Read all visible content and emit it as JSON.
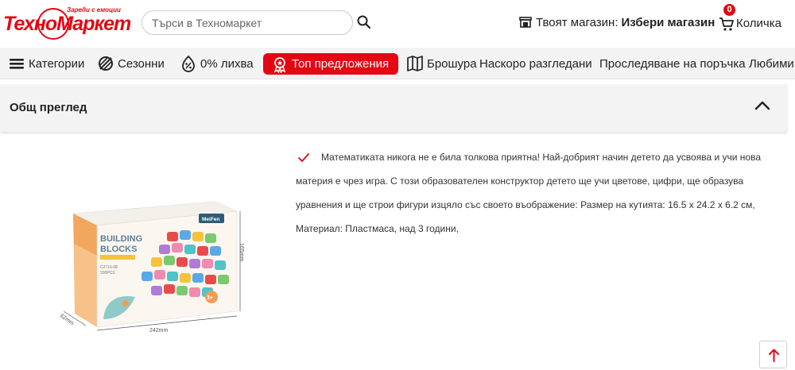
{
  "header": {
    "logo_text": "ТехноМаркет",
    "logo_tagline": "Зареди с емоции",
    "search_placeholder": "Търси в Техномаркет",
    "store_label": "Твоят магазин:",
    "store_value": "Избери магазин",
    "cart_count": "0",
    "cart_label": "Количка"
  },
  "nav": {
    "items": [
      {
        "label": "Категории",
        "icon": "menu-icon"
      },
      {
        "label": "Сезонни",
        "icon": "seasonal-icon"
      },
      {
        "label": "0% лихва",
        "icon": "percent-icon"
      },
      {
        "label": "Топ предложения",
        "icon": "award-icon"
      },
      {
        "label": "Брошура",
        "icon": "brochure-icon"
      },
      {
        "label": "Наскоро разгледани"
      },
      {
        "label": "Проследяване на поръчка"
      },
      {
        "label": "Любими"
      }
    ]
  },
  "overview": {
    "title": "Общ преглед"
  },
  "product": {
    "description": "Математиката никога не е била толкова приятна! Най-добрият начин детето да усвоява и учи нова материя е чрез игра. С този образователен конструктор детето ще учи цветове, цифри, ще образува уравнения и ще строи фигури изцяло със своето въображение: Размер на кутията: 16.5 х 24.2 х 6.2 см, Материал: Пластмаса, над 3 години,",
    "box_title_1": "BUILDING",
    "box_title_2": "BLOCKS",
    "box_code": "C2716-08",
    "box_pcs": "200PCS",
    "box_brand": "MeiFen",
    "box_age": "3+",
    "dim_width": "242mm",
    "dim_height": "165mm",
    "dim_depth": "62mm"
  },
  "colors": {
    "brand_red": "#e30613",
    "nav_bg": "#f3f3f3"
  }
}
